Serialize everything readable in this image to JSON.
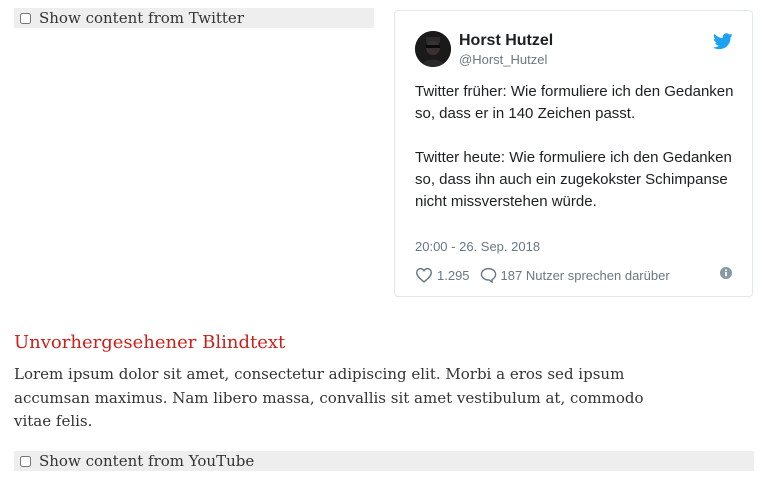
{
  "consent": {
    "twitter_label": "Show content from Twitter",
    "youtube_label": "Show content from YouTube"
  },
  "tweet": {
    "author_name": "Horst Hutzel",
    "author_handle": "@Horst_Hutzel",
    "paragraph_1": "Twitter früher: Wie formuliere ich den Gedanken so, dass er in 140 Zeichen passt.",
    "paragraph_2": "Twitter heute: Wie formuliere ich den Gedanken so, dass ihn auch ein zugekokster Schimpanse nicht missverstehen würde.",
    "timestamp": "20:00 - 26. Sep. 2018",
    "likes": "1.295",
    "replies": "187 Nutzer sprechen darüber",
    "icons": {
      "brand": "twitter-bird-icon",
      "like": "heart-icon",
      "reply": "speech-bubble-icon",
      "info": "info-icon"
    },
    "colors": {
      "brand": "#1da1f2",
      "muted": "#697882",
      "text": "#1c2022"
    }
  },
  "article": {
    "title": "Unvorhergesehener Blindtext",
    "body": "Lorem ipsum dolor sit amet, consectetur adipiscing elit. Morbi a eros sed ipsum accumsan maximus. Nam libero massa, convallis sit amet vestibulum at, commodo vitae felis.",
    "title_color": "#cc1f1a"
  }
}
